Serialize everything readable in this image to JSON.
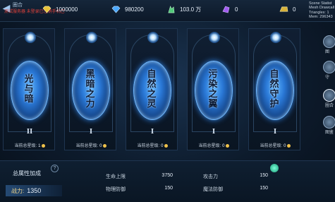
{
  "header": {
    "title": "圈合",
    "warning": "测试服务器 未登录已注销手机已",
    "resources": [
      {
        "icon": "diamond-icon",
        "value": "1000000",
        "color": "#e8c23a"
      },
      {
        "icon": "blue-gem-icon",
        "value": "980200",
        "color": "#4aa8ff"
      },
      {
        "icon": "green-crystal-icon",
        "value": "103.0 万",
        "color": "#52c97a"
      },
      {
        "icon": "purple-crystal-icon",
        "value": "0",
        "color": "#a15cf0"
      },
      {
        "icon": "gold-ingot-icon",
        "value": "0",
        "color": "#d8b23a"
      }
    ],
    "debug": "Scene Statist\nMesh Drawcall\nTriangles: 1\nMem: 296343"
  },
  "cards": [
    {
      "name_lines": [
        "光",
        "与",
        "暗"
      ],
      "numeral": "II",
      "star_label": "当前总星级:",
      "star_value": "1"
    },
    {
      "name_lines": [
        "黑",
        "暗",
        "之",
        "力"
      ],
      "numeral": "I",
      "star_label": "当前总星级:",
      "star_value": "0"
    },
    {
      "name_lines": [
        "自",
        "然",
        "之",
        "灵"
      ],
      "numeral": "I",
      "star_label": "当前总星级:",
      "star_value": "0"
    },
    {
      "name_lines": [
        "污",
        "染",
        "之",
        "翼"
      ],
      "numeral": "I",
      "star_label": "当前总星级:",
      "star_value": "0"
    },
    {
      "name_lines": [
        "自",
        "然",
        "守",
        "护"
      ],
      "numeral": "I",
      "star_label": "当前总星级:",
      "star_value": "0"
    }
  ],
  "sidebar": {
    "labels": [
      "图",
      "守",
      "圈合",
      "图鉴"
    ]
  },
  "bottom": {
    "total_label": "总属性加成",
    "help": "?",
    "power_label": "战力:",
    "power_value": "1350",
    "stats": [
      {
        "label": "生命上限",
        "value": "3750"
      },
      {
        "label": "攻击力",
        "value": "150"
      },
      {
        "label": "物理防御",
        "value": "150"
      },
      {
        "label": "魔法防御",
        "value": "150"
      }
    ]
  }
}
